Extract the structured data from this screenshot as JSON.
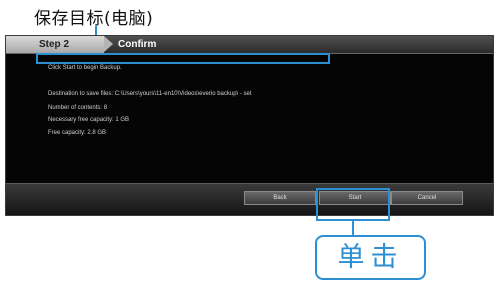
{
  "annotation": {
    "top_label": "保存目标(电脑)",
    "click_label": "单击"
  },
  "window": {
    "step_label": "Step 2",
    "step_title": "Confirm",
    "lines": [
      "Click Start to begin Backup.",
      "Destination to save files: C:\\Users\\yours\\11-en10\\Videos\\everio backup\\ - set",
      "Number of contents: 8",
      "Necessary free capacity: 1 GB",
      "Free capacity: 2.8 GB"
    ]
  },
  "buttons": {
    "back": "Back",
    "start": "Start",
    "cancel": "Cancel"
  },
  "colors": {
    "accent": "#2c8fd4",
    "window_bg": "#050505"
  }
}
